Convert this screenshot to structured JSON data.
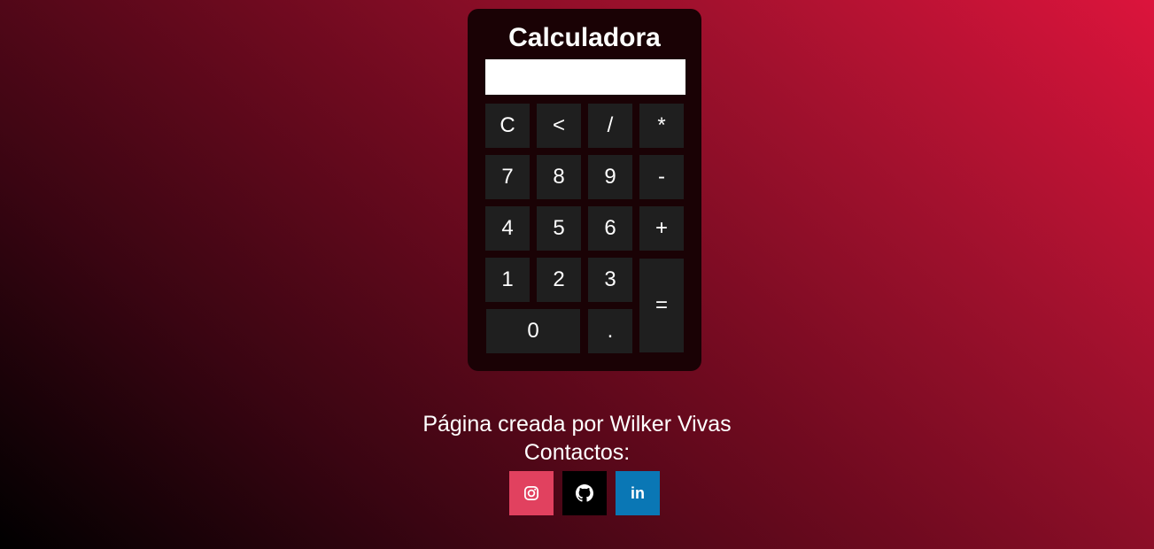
{
  "calculator": {
    "title": "Calculadora",
    "display_value": "",
    "keys": {
      "clear": "C",
      "backspace": "<",
      "divide": "/",
      "multiply": "*",
      "seven": "7",
      "eight": "8",
      "nine": "9",
      "minus": "-",
      "four": "4",
      "five": "5",
      "six": "6",
      "plus": "+",
      "one": "1",
      "two": "2",
      "three": "3",
      "equals": "=",
      "zero": "0",
      "decimal": "."
    }
  },
  "footer": {
    "credit": "Página creada por Wilker Vivas",
    "contacts_label": "Contactos:",
    "social": [
      {
        "icon": "instagram-icon",
        "color": "#e1415f"
      },
      {
        "icon": "github-icon",
        "color": "#000000"
      },
      {
        "icon": "linkedin-icon",
        "color": "#0a77b5",
        "label": "in"
      }
    ]
  },
  "colors": {
    "background_start": "#000000",
    "background_end": "#dc143c",
    "calculator_body": "#1a0205",
    "key_bg": "#1f1f1f"
  }
}
